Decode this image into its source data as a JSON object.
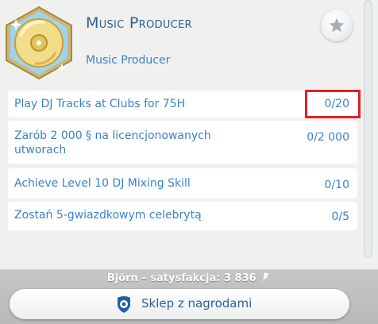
{
  "career": {
    "title": "Music Producer",
    "subtitle": "Music Producer",
    "badge_icon": "vinyl-disc-icon",
    "favorite_icon": "star-icon"
  },
  "tasks": [
    {
      "label": "Play DJ Tracks at Clubs for 75H",
      "progress": "0/20",
      "highlighted": true
    },
    {
      "label": "Zarób 2  000  § na licencjonowanych utworach",
      "progress": "0/2  000",
      "highlighted": false
    },
    {
      "label": "Achieve Level 10 DJ Mixing Skill",
      "progress": "0/10",
      "highlighted": false
    },
    {
      "label": "Zostań 5-gwiazdkowym celebrytą",
      "progress": "0/5",
      "highlighted": false
    }
  ],
  "footer": {
    "satisfaction": "Björn – satysfakcja: 3  836",
    "satisfaction_icon": "satisfaction-icon",
    "store_label": "Sklep z nagrodami",
    "store_icon": "reward-store-icon"
  },
  "colors": {
    "accent": "#3a82c8",
    "title": "#2d5f93",
    "highlight": "#e0202a",
    "panel_bg": "#f0f1ef",
    "footer_bg": "#c2c2c2"
  }
}
